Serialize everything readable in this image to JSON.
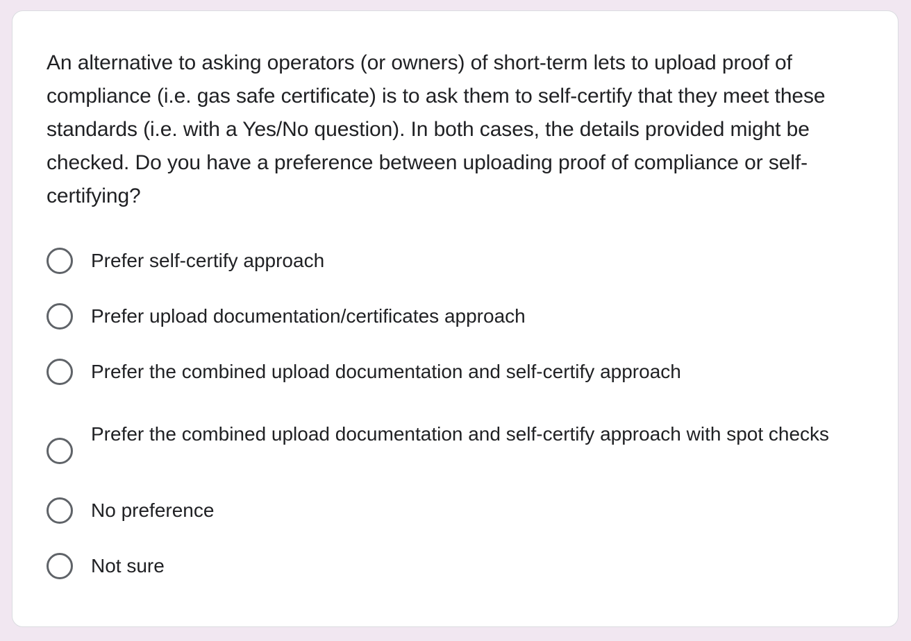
{
  "question": {
    "text": "An alternative to asking operators (or owners) of short-term lets to upload proof of compliance (i.e. gas safe certificate) is to ask them to self-certify that they meet these standards (i.e. with a Yes/No question). In both cases, the details provided might be checked. Do you have a preference between uploading proof of compliance or self-certifying?"
  },
  "options": [
    {
      "label": "Prefer self-certify approach"
    },
    {
      "label": "Prefer upload documentation/certificates approach"
    },
    {
      "label": "Prefer the combined upload documentation and self-certify approach"
    },
    {
      "label": "Prefer the combined upload documentation and self-certify approach with spot checks"
    },
    {
      "label": "No preference"
    },
    {
      "label": "Not sure"
    }
  ],
  "colors": {
    "page_background": "#f1e7f1",
    "card_background": "#ffffff",
    "text": "#202124",
    "radio_border": "#5f6368"
  }
}
